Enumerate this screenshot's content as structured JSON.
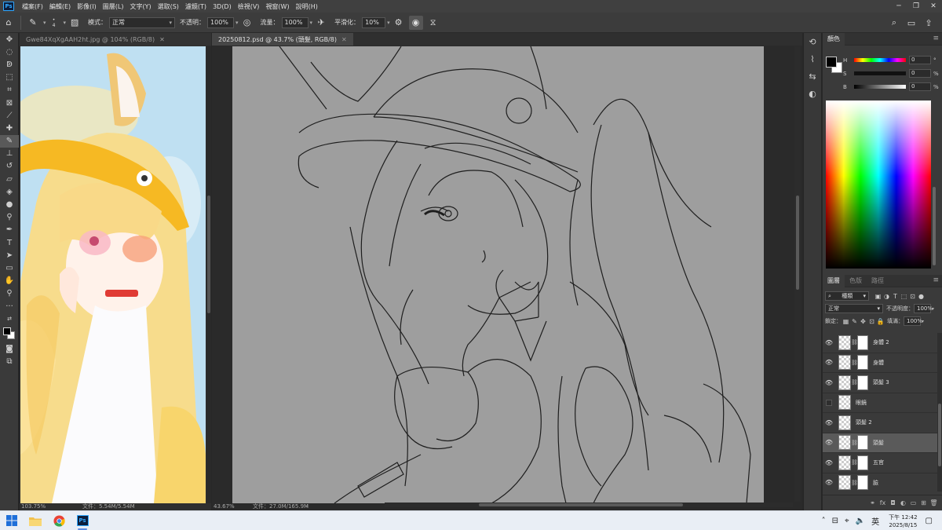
{
  "app": {
    "logo": "Ps"
  },
  "menu": [
    "檔案(F)",
    "編輯(E)",
    "影像(I)",
    "圖層(L)",
    "文字(Y)",
    "選取(S)",
    "濾鏡(T)",
    "3D(D)",
    "檢視(V)",
    "視窗(W)",
    "說明(H)"
  ],
  "options": {
    "brush_size": "4",
    "mode_label": "模式：",
    "mode_value": "正常",
    "opacity_label": "不透明：",
    "opacity_value": "100%",
    "flow_label": "流量：",
    "flow_value": "100%",
    "smooth_label": "平滑化：",
    "smooth_value": "10%"
  },
  "doc1": {
    "tab": "Gwe84XqXgAAH2ht.jpg @ 104% (RGB/8)",
    "zoom": "103.75%",
    "file": "文件：5.54M/5.54M"
  },
  "doc2": {
    "tab": "20250812.psd @ 43.7% (頭髮, RGB/8)",
    "zoom": "43.67%",
    "file": "文件：27.0M/165.9M"
  },
  "color_panel": {
    "tab": "顏色",
    "h_label": "H",
    "h_value": "0",
    "s_label": "S",
    "s_value": "0",
    "s_unit": "%",
    "b_label": "B",
    "b_value": "0",
    "b_unit": "%"
  },
  "layers_panel": {
    "tabs": [
      "圖層",
      "色版",
      "路徑"
    ],
    "filter": "種類",
    "blend": "正常",
    "opacity_label": "不透明度：",
    "opacity_value": "100%",
    "lock_label": "鎖定：",
    "fill_label": "填滿：",
    "fill_value": "100%",
    "layers": [
      {
        "name": "身體 2",
        "visible": true,
        "mask": true,
        "selected": false
      },
      {
        "name": "身體",
        "visible": true,
        "mask": true,
        "selected": false
      },
      {
        "name": "頭髮 3",
        "visible": true,
        "mask": true,
        "selected": false
      },
      {
        "name": "眼鏡",
        "visible": false,
        "mask": false,
        "selected": false
      },
      {
        "name": "頭髮 2",
        "visible": true,
        "mask": false,
        "selected": false
      },
      {
        "name": "頭髮",
        "visible": true,
        "mask": true,
        "selected": true
      },
      {
        "name": "五官",
        "visible": true,
        "mask": true,
        "selected": false
      },
      {
        "name": "臉",
        "visible": true,
        "mask": true,
        "selected": false
      }
    ]
  },
  "taskbar": {
    "lang": "英",
    "time": "下午 12:42",
    "date": "2025/8/15"
  },
  "colors": {
    "accent": "#31a8ff",
    "canvas_gray": "#9e9e9e"
  }
}
